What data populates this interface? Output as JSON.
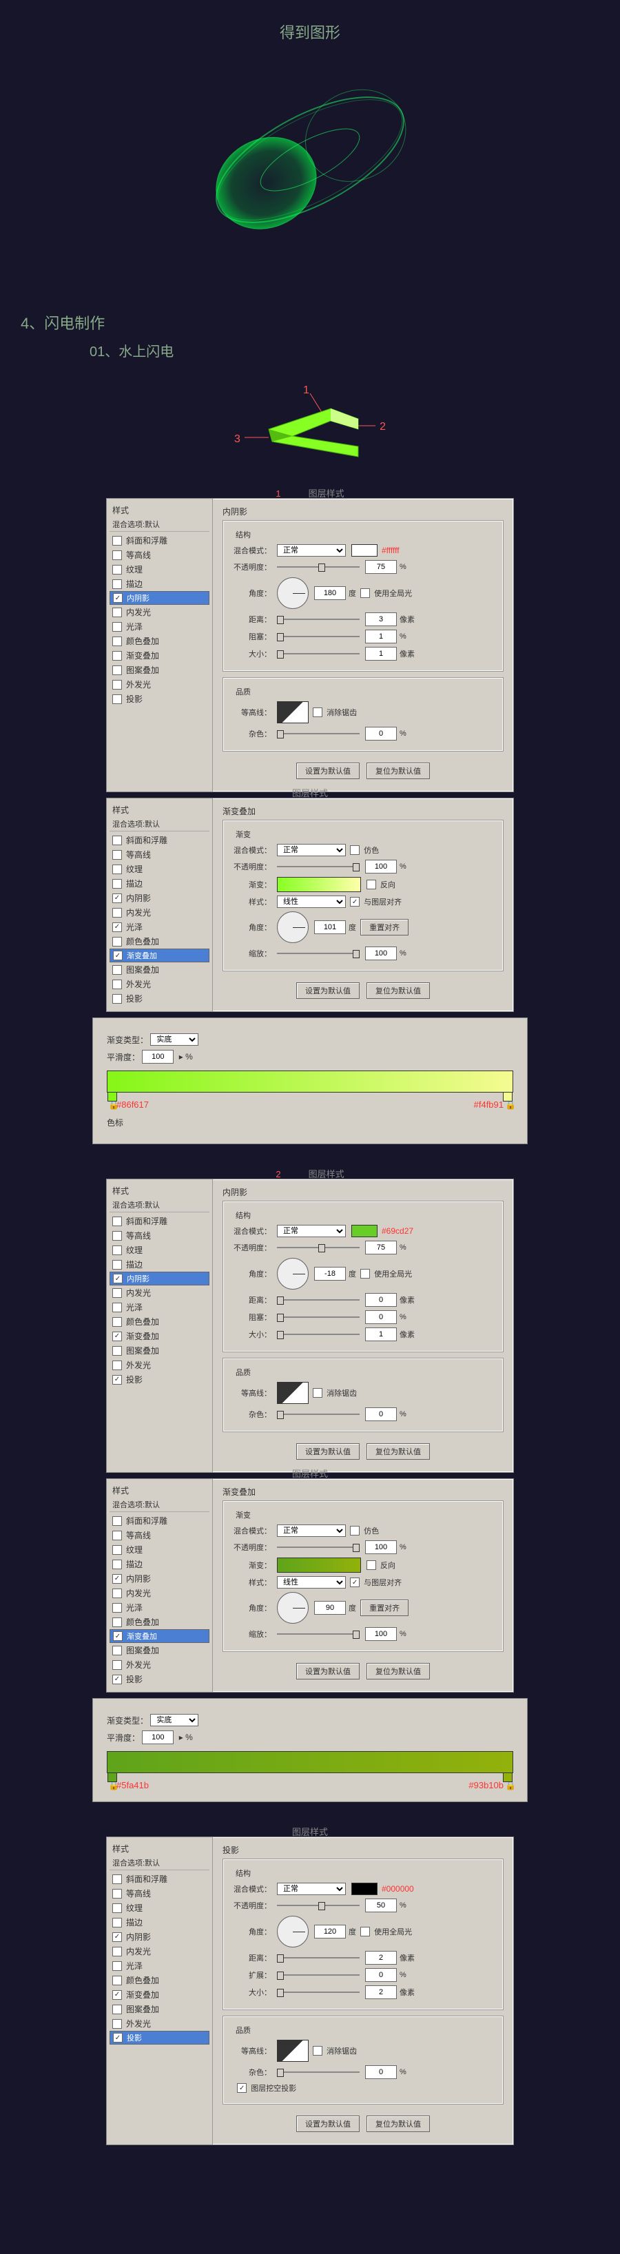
{
  "title": "得到图形",
  "section4": {
    "num": "4、",
    "label": "闪电制作"
  },
  "sub01": {
    "num": "01、",
    "label": "水上闪电"
  },
  "arrow_nums": {
    "n1": "1",
    "n2": "2",
    "n3": "3"
  },
  "panel_title_suffix": "图层样式",
  "sidebar": {
    "header": "样式",
    "header2": "混合选项:默认",
    "items": [
      "斜面和浮雕",
      "等高线",
      "纹理",
      "描边",
      "内阴影",
      "内发光",
      "光泽",
      "颜色叠加",
      "渐变叠加",
      "图案叠加",
      "外发光",
      "投影"
    ]
  },
  "p1": {
    "num": "1",
    "title": "内阴影",
    "sub": "结构",
    "blend": "正常",
    "hex": "#ffffff",
    "opacity": "75",
    "angle": "180",
    "use_global": "使用全局光",
    "dist": "3",
    "choke": "1",
    "size": "1",
    "quality": "品质",
    "anti": "消除锯齿",
    "noise": "0",
    "checked": [
      "内阴影"
    ],
    "selected": "内阴影"
  },
  "labels": {
    "blend": "混合模式：",
    "opacity": "不透明度：",
    "angle": "角度：",
    "deg": "度",
    "dist": "距离：",
    "choke": "阻塞：",
    "spread": "扩展：",
    "size": "大小：",
    "px": "像素",
    "pct": "%",
    "contour": "等高线：",
    "noise": "杂色：",
    "set_default": "设置为默认值",
    "reset_default": "复位为默认值",
    "dither": "仿色",
    "reverse": "反向",
    "gradient": "渐变：",
    "style": "样式：",
    "linear": "线性",
    "align": "与图层对齐",
    "scale": "缩放：",
    "reset_align": "重置对齐",
    "knockout": "图层挖空投影"
  },
  "p2": {
    "title": "渐变叠加",
    "sub": "渐变",
    "blend": "正常",
    "opacity": "100",
    "angle": "101",
    "scale": "100",
    "checked": [
      "内阴影",
      "光泽",
      "渐变叠加"
    ],
    "selected": "渐变叠加"
  },
  "grad1": {
    "type_label": "渐变类型：",
    "type": "实底",
    "smooth_label": "平滑度：",
    "smooth": "100",
    "left": "#86f617",
    "right": "#f4fb91",
    "stops_label": "色标"
  },
  "p3": {
    "num": "2",
    "title": "内阴影",
    "sub": "结构",
    "blend": "正常",
    "hex": "#69cd27",
    "opacity": "75",
    "angle": "-18",
    "use_global": "使用全局光",
    "dist": "0",
    "choke": "0",
    "size": "1",
    "noise": "0",
    "checked": [
      "内阴影",
      "渐变叠加",
      "投影"
    ],
    "selected": "内阴影"
  },
  "p4": {
    "title": "渐变叠加",
    "sub": "渐变",
    "blend": "正常",
    "opacity": "100",
    "angle": "90",
    "scale": "100",
    "checked": [
      "内阴影",
      "渐变叠加",
      "投影"
    ],
    "selected": "渐变叠加"
  },
  "grad2": {
    "type_label": "渐变类型：",
    "type": "实底",
    "smooth_label": "平滑度：",
    "smooth": "100",
    "left": "#5fa41b",
    "right": "#93b10b"
  },
  "p5": {
    "title": "投影",
    "sub": "结构",
    "blend": "正常",
    "hex": "#000000",
    "opacity": "50",
    "angle": "120",
    "use_global": "使用全局光",
    "dist": "2",
    "spread": "0",
    "size": "2",
    "noise": "0",
    "checked": [
      "内阴影",
      "渐变叠加",
      "投影"
    ],
    "selected": "投影"
  }
}
